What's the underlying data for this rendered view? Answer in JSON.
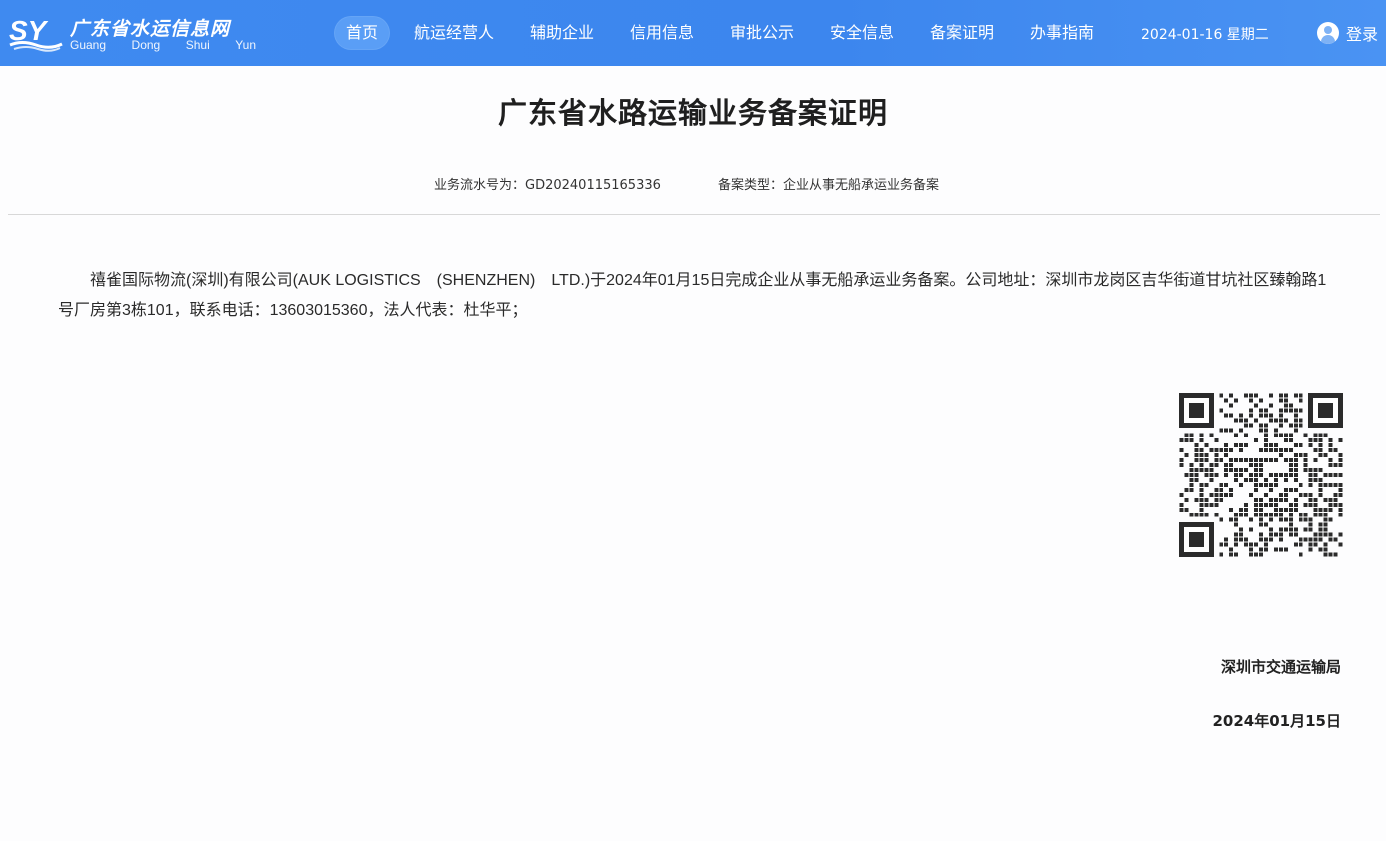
{
  "header": {
    "logo_mark": "SY",
    "logo_title": "广东省水运信息网",
    "logo_sub": [
      "Guang",
      "Dong",
      "Shui",
      "Yun"
    ],
    "nav": [
      "首页",
      "航运经营人",
      "辅助企业",
      "信用信息",
      "审批公示",
      "安全信息",
      "备案证明",
      "办事指南"
    ],
    "active_nav": "首页",
    "date": "2024-01-16 星期二",
    "login_label": "登录",
    "login_icon": "user-icon",
    "colors": {
      "bar": "#3f8af0",
      "active_pill": "#5a9ef6"
    }
  },
  "document": {
    "title": "广东省水路运输业务备案证明",
    "serial": "业务流水号为：GD20240115165336",
    "record_type": "备案类型：企业从事无船承运业务备案",
    "body": "禧雀国际物流(深圳)有限公司(AUK LOGISTICS　(SHENZHEN)　LTD.)于2024年01月15日完成企业从事无船承运业务备案。公司地址：深圳市龙岗区吉华街道甘坑社区臻翰路1号厂房第3栋101，联系电话：13603015360，法人代表：杜华平；",
    "qr_icon": "qr-code-icon",
    "authority": "深圳市交通运输局",
    "issue_date": "2024年01月15日"
  }
}
